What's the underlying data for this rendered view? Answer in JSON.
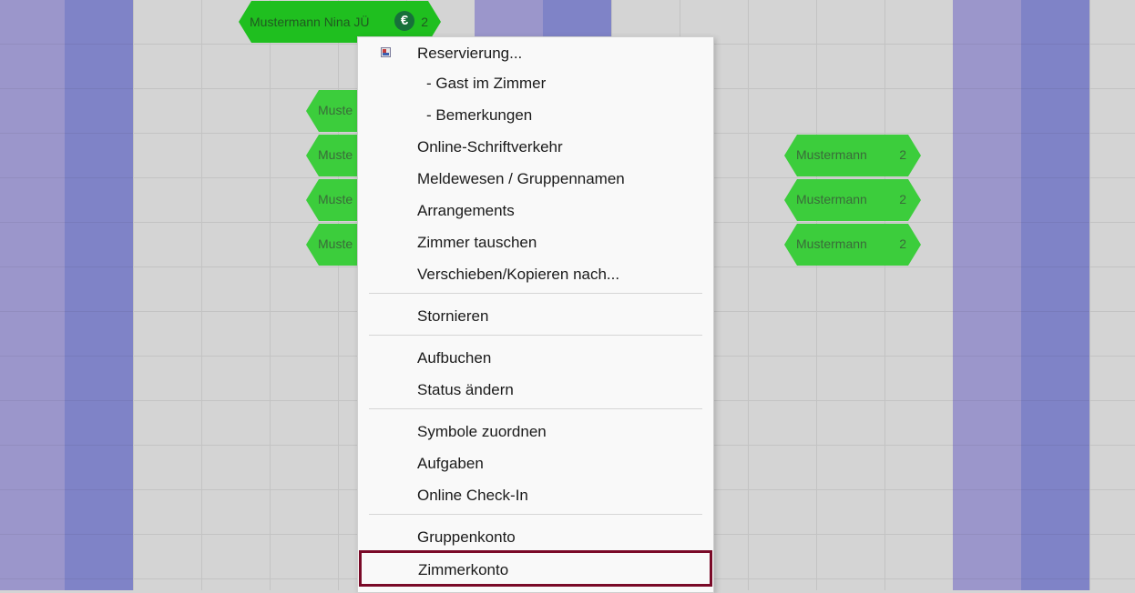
{
  "planner": {
    "top_reservation": {
      "name": "Mustermann Nina JÜ",
      "count": "2",
      "icon": "euro-icon"
    },
    "left_reservations": [
      {
        "name": "Muste"
      },
      {
        "name": "Muste"
      },
      {
        "name": "Muste"
      },
      {
        "name": "Muste"
      }
    ],
    "right_reservations": [
      {
        "name": "Mustermann",
        "count": "2"
      },
      {
        "name": "Mustermann",
        "count": "2"
      },
      {
        "name": "Mustermann",
        "count": "2"
      }
    ]
  },
  "context_menu": {
    "items": [
      {
        "label": "Reservierung...",
        "icon": "reservation-icon"
      },
      {
        "label": "- Gast im Zimmer"
      },
      {
        "label": "- Bemerkungen"
      },
      {
        "label": "Online-Schriftverkehr"
      },
      {
        "label": "Meldewesen / Gruppennamen"
      },
      {
        "label": "Arrangements"
      },
      {
        "label": "Zimmer tauschen"
      },
      {
        "label": "Verschieben/Kopieren nach..."
      },
      {
        "label": "Stornieren"
      },
      {
        "label": "Aufbuchen"
      },
      {
        "label": "Status ändern"
      },
      {
        "label": "Symbole zuordnen"
      },
      {
        "label": "Aufgaben"
      },
      {
        "label": "Online Check-In"
      },
      {
        "label": "Gruppenkonto"
      },
      {
        "label": "Zimmerkonto",
        "selected": true
      }
    ],
    "highlight_color": "#7a0a28"
  },
  "colors": {
    "grid_background": "#d4d4d4",
    "column_light": "#9b96cb",
    "column_dark": "#7f83c7",
    "reservation_green": "#3ccd3c"
  }
}
